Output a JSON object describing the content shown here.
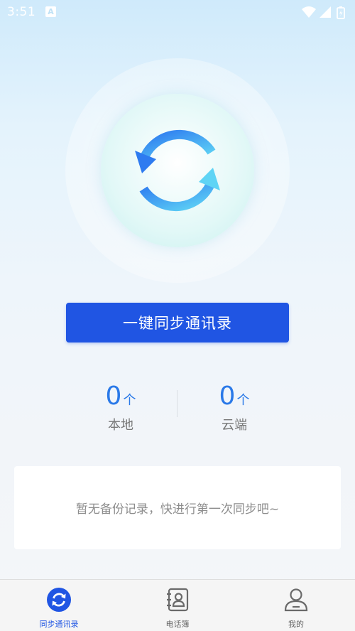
{
  "status_bar": {
    "time": "3:51",
    "notification_badge": "A",
    "icons": [
      "wifi-icon",
      "cell-signal-icon",
      "battery-icon"
    ]
  },
  "sync_graphic": {
    "icon": "sync-icon"
  },
  "main": {
    "sync_button_label": "一键同步通讯录",
    "stats": {
      "local": {
        "value": "0",
        "unit": "个",
        "label": "本地"
      },
      "cloud": {
        "value": "0",
        "unit": "个",
        "label": "云端"
      }
    },
    "empty_message": "暂无备份记录，快进行第一次同步吧~"
  },
  "tab_bar": {
    "items": [
      {
        "label": "同步通讯录",
        "icon": "sync-circle-icon",
        "active": true
      },
      {
        "label": "电话簿",
        "icon": "phonebook-icon",
        "active": false
      },
      {
        "label": "我的",
        "icon": "user-icon",
        "active": false
      }
    ]
  },
  "colors": {
    "accent": "#2055e3",
    "stat_value": "#2a79e8",
    "sync_icon_gradient": [
      "#2e7bf0",
      "#5fd4f5"
    ],
    "background_top": "#cfeafb",
    "background_bottom": "#f4f6f9"
  }
}
